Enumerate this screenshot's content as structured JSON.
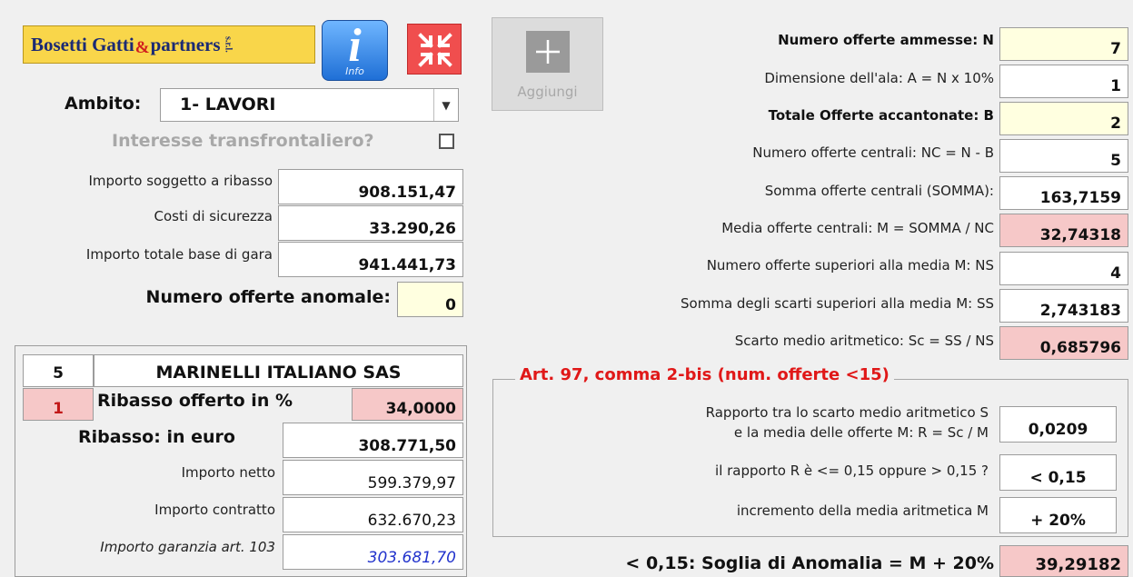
{
  "header": {
    "logo": "Bosetti Gatti & partners s.r.l.",
    "logo_main": "Bosetti Gatti",
    "logo_amp": "&",
    "logo_partners": "partners",
    "logo_srl": "s.r.l.",
    "info_button": "Info",
    "add_button": "Aggiungi"
  },
  "ambito": {
    "label": "Ambito:",
    "value": "1- LAVORI",
    "transfrontaliero_label": "Interesse transfrontaliero?",
    "transfrontaliero_checked": false
  },
  "importi": {
    "soggetto_label": "Importo soggetto a ribasso",
    "soggetto_value": "908.151,47",
    "sicurezza_label": "Costi di sicurezza",
    "sicurezza_value": "33.290,26",
    "totale_label": "Importo totale base di gara",
    "totale_value": "941.441,73",
    "anomale_label": "Numero offerte anomale:",
    "anomale_value": "0"
  },
  "offerta": {
    "numero": "5",
    "ditta": "MARINELLI ITALIANO SAS",
    "posizione": "1",
    "ribasso_label": "Ribasso offerto in %",
    "ribasso_value": "34,0000",
    "ribasso_euro_label": "Ribasso: in euro",
    "ribasso_euro_value": "308.771,50",
    "netto_label": "Importo netto",
    "netto_value": "599.379,97",
    "contratto_label": "Importo contratto",
    "contratto_value": "632.670,23",
    "garanzia_label": "Importo garanzia art. 103",
    "garanzia_value": "303.681,70"
  },
  "calcoli": {
    "ammesse_label": "Numero offerte ammesse: N",
    "ammesse_value": "7",
    "ala_label": "Dimensione dell'ala: A = N x 10%",
    "ala_value": "1",
    "accantonate_label": "Totale Offerte accantonate: B",
    "accantonate_value": "2",
    "centrali_label": "Numero offerte centrali: NC = N - B",
    "centrali_value": "5",
    "somma_label": "Somma offerte centrali (SOMMA):",
    "somma_value": "163,7159",
    "media_label": "Media offerte centrali: M = SOMMA / NC",
    "media_value": "32,74318",
    "superiori_label": "Numero offerte superiori alla media M: NS",
    "superiori_value": "4",
    "scarti_label": "Somma degli scarti superiori alla media M: SS",
    "scarti_value": "2,743183",
    "scarto_medio_label": "Scarto medio aritmetico: Sc = SS / NS",
    "scarto_medio_value": "0,685796"
  },
  "art97": {
    "title": "Art. 97, comma 2-bis (num. offerte <15)",
    "rapporto_label_1": "Rapporto tra lo scarto medio aritmetico S",
    "rapporto_label_2": "e la media delle offerte M: R = Sc / M",
    "rapporto_value": "0,0209",
    "confronto_label": "il rapporto R è <= 0,15 oppure > 0,15 ?",
    "confronto_value": "< 0,15",
    "incremento_label": "incremento della media aritmetica M",
    "incremento_value": "+ 20%"
  },
  "soglia": {
    "label": "< 0,15: Soglia di Anomalia = M + 20%",
    "value": "39,29182"
  },
  "colors": {
    "yellow_cell": "#ffffe0",
    "pink_cell": "#f6c8c8",
    "red_title": "#e01818",
    "logo_bg": "#f9d64a"
  }
}
